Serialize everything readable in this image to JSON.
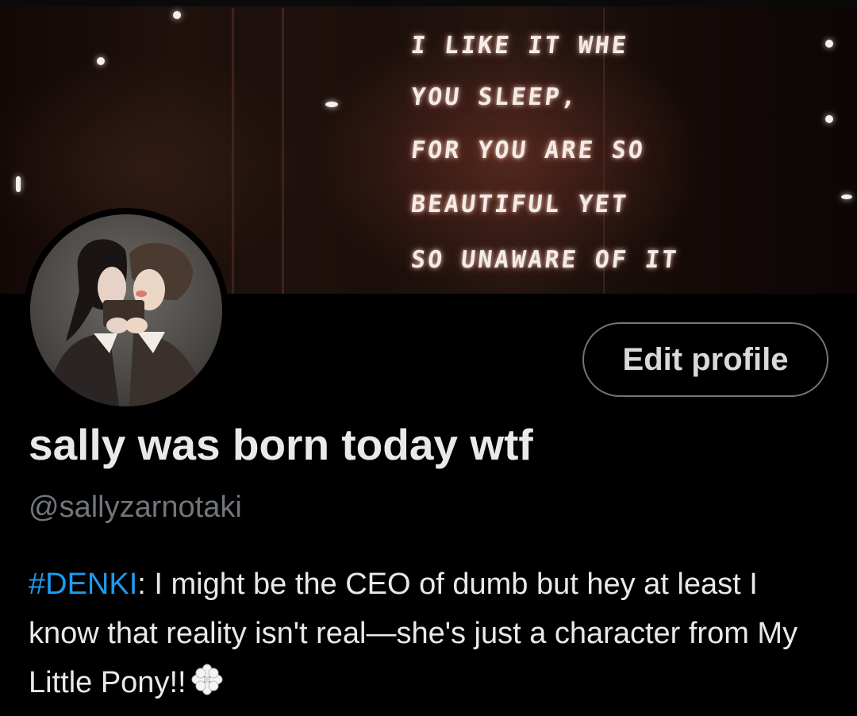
{
  "banner": {
    "neon_lines": [
      "I LIKE IT WHE",
      "YOU SLEEP,",
      "FOR YOU ARE SO",
      "BEAUTIFUL YET",
      "SO UNAWARE OF IT"
    ]
  },
  "profile": {
    "display_name": "sally was born today wtf",
    "handle": "@sallyzarnotaki",
    "edit_button": "Edit profile",
    "bio": {
      "hashtag": "#DENKI",
      "text": ": I might be the CEO of dumb but hey at least I know that reality isn't real—she's just a character from My Little Pony!!",
      "emoji_icon": "white-flower-icon"
    }
  },
  "colors": {
    "background": "#000000",
    "text_primary": "#e7e9ea",
    "text_secondary": "#71767b",
    "hashtag": "#1d9bf0",
    "button_border": "#6e767d"
  }
}
